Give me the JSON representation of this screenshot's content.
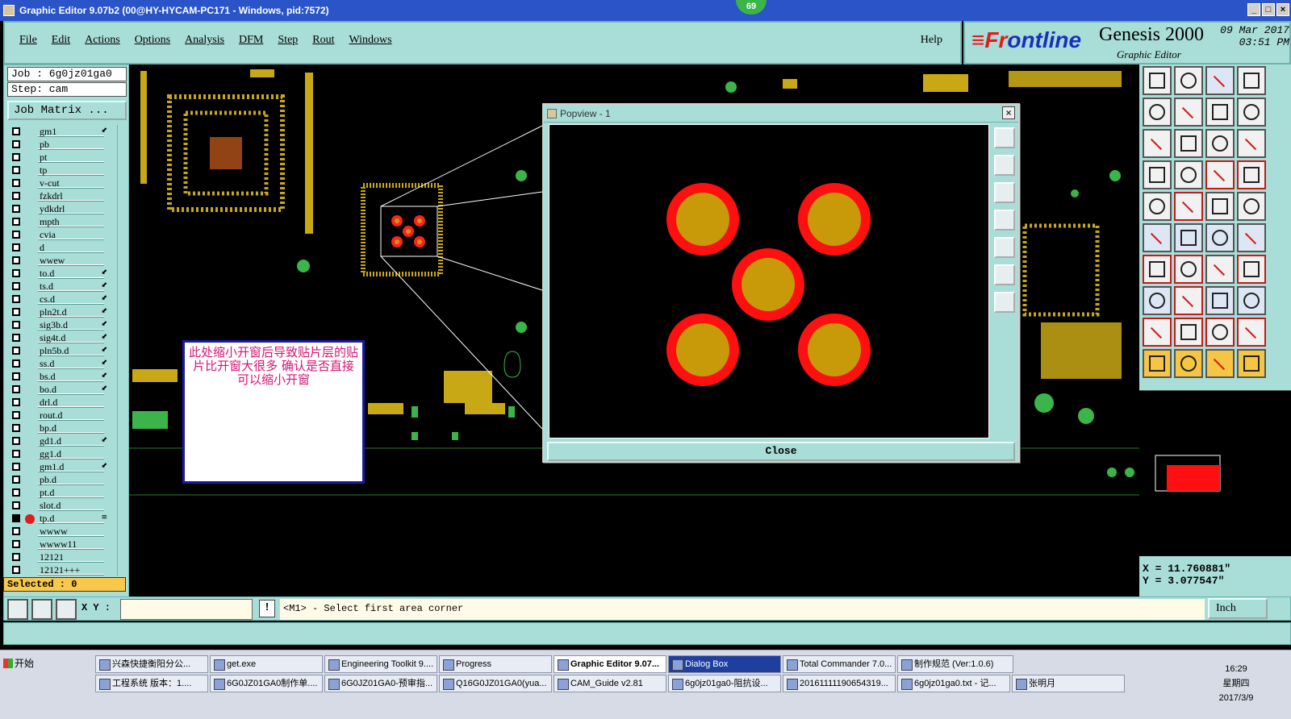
{
  "window": {
    "title": "Graphic Editor 9.07b2 (00@HY-HYCAM-PC171 - Windows, pid:7572)",
    "badge": "69"
  },
  "menu": {
    "items": [
      "File",
      "Edit",
      "Actions",
      "Options",
      "Analysis",
      "DFM",
      "Step",
      "Rout",
      "Windows"
    ],
    "help": "Help"
  },
  "brand": {
    "logo_a": "≡Fr",
    "logo_b": "ontline",
    "product": "Genesis 2000",
    "subtitle": "Graphic Editor",
    "date": "09 Mar 2017",
    "time": "03:51 PM"
  },
  "job": {
    "job_line": "Job : 6g0jz01ga0",
    "step_line": "Step: cam",
    "matrix_button": "Job Matrix ...",
    "selected": "Selected : 0"
  },
  "layers": [
    {
      "name": "gm1",
      "mark": "⬋"
    },
    {
      "name": "pb",
      "mark": ""
    },
    {
      "name": "pt",
      "mark": ""
    },
    {
      "name": "tp",
      "mark": ""
    },
    {
      "name": "v-cut",
      "mark": ""
    },
    {
      "name": "fzkdrl",
      "mark": ""
    },
    {
      "name": "ydkdrl",
      "mark": ""
    },
    {
      "name": "mpth",
      "mark": ""
    },
    {
      "name": "cvia",
      "mark": ""
    },
    {
      "name": "d",
      "mark": ""
    },
    {
      "name": "wwew",
      "mark": ""
    },
    {
      "name": "to.d",
      "mark": "⬋"
    },
    {
      "name": "ts.d",
      "mark": "⬋"
    },
    {
      "name": "cs.d",
      "mark": "⬋"
    },
    {
      "name": "pln2t.d",
      "mark": "⬋"
    },
    {
      "name": "sig3b.d",
      "mark": "⬋"
    },
    {
      "name": "sig4t.d",
      "mark": "⬋"
    },
    {
      "name": "pln5b.d",
      "mark": "⬋"
    },
    {
      "name": "ss.d",
      "mark": "⬋"
    },
    {
      "name": "bs.d",
      "mark": "⬋"
    },
    {
      "name": "bo.d",
      "mark": "⬋"
    },
    {
      "name": "drl.d",
      "mark": ""
    },
    {
      "name": "rout.d",
      "mark": ""
    },
    {
      "name": "bp.d",
      "mark": ""
    },
    {
      "name": "gd1.d",
      "mark": "⬋"
    },
    {
      "name": "gg1.d",
      "mark": ""
    },
    {
      "name": "gm1.d",
      "mark": "⬋"
    },
    {
      "name": "pb.d",
      "mark": ""
    },
    {
      "name": "pt.d",
      "mark": ""
    },
    {
      "name": "slot.d",
      "mark": ""
    },
    {
      "name": "tp.d",
      "mark": "≡",
      "active": true
    },
    {
      "name": "wwww",
      "mark": ""
    },
    {
      "name": "wwww11",
      "mark": ""
    },
    {
      "name": "12121",
      "mark": ""
    },
    {
      "name": "12121+++",
      "mark": ""
    }
  ],
  "note": {
    "text": "此处缩小开窗后导致贴片层的贴片比开窗大很多   确认是否直接可以缩小开窗"
  },
  "popview": {
    "title": "Popview - 1",
    "close_x": "×",
    "close_button": "Close"
  },
  "coords": {
    "x": "X = 11.760881\"",
    "y": "Y = 3.077547\""
  },
  "statusbar": {
    "xy_label": "X Y :",
    "message": "<M1> - Select first area corner",
    "units": "Inch",
    "excl": "!"
  },
  "taskbar": {
    "start": "开始",
    "row1": [
      "兴森快捷衡阳分公...",
      "get.exe",
      "Engineering Toolkit 9....",
      "Progress",
      "Graphic Editor 9.07...",
      "Dialog Box",
      "Total Commander 7.0...",
      "制作规范 (Ver:1.0.6)"
    ],
    "row2": [
      "工程系统  版本：1....",
      "6G0JZ01GA0制作单....",
      "6G0JZ01GA0-预审指...",
      "Q16G0JZ01GA0(yua...",
      "CAM_Guide v2.81",
      "6g0jz01ga0-阻抗设...",
      "20161111190654319...",
      "6g0jz01ga0.txt - 记...",
      "张明月"
    ],
    "time": "16:29",
    "weekday": "星期四",
    "date": "2017/3/9"
  },
  "colors": {
    "accent": "#a9ddd7",
    "pad_outer": "#ff1010",
    "pad_inner": "#c89a0a"
  }
}
